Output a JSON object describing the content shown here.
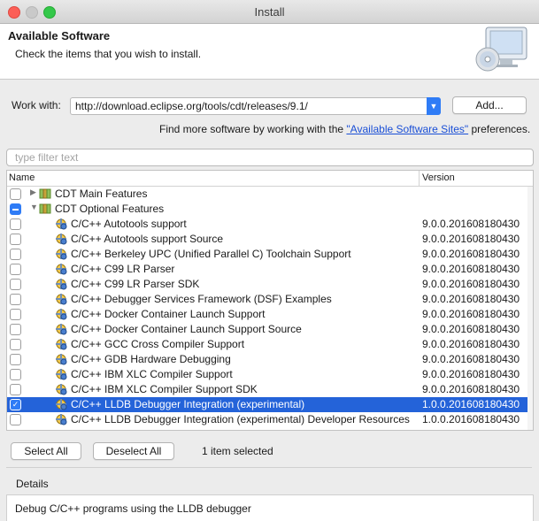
{
  "window": {
    "title": "Install"
  },
  "header": {
    "title": "Available Software",
    "subtitle": "Check the items that you wish to install."
  },
  "work_with": {
    "label": "Work with:",
    "url": "http://download.eclipse.org/tools/cdt/releases/9.1/",
    "add_label": "Add..."
  },
  "find_more": {
    "prefix": "Find more software by working with the ",
    "link": "\"Available Software Sites\"",
    "suffix": " preferences."
  },
  "filter": {
    "placeholder": "type filter text"
  },
  "table": {
    "col_name": "Name",
    "col_version": "Version",
    "rows": [
      {
        "name": "CDT Main Features",
        "version": "",
        "level": 0,
        "check": "none",
        "twisty": "▶",
        "icon": "feature-category-icon",
        "selected": false
      },
      {
        "name": "CDT Optional Features",
        "version": "",
        "level": 0,
        "check": "partial",
        "twisty": "▼",
        "icon": "feature-category-icon",
        "selected": false
      },
      {
        "name": "C/C++ Autotools support",
        "version": "9.0.0.201608180430",
        "level": 1,
        "check": "none",
        "icon": "plugin-feature-icon",
        "selected": false
      },
      {
        "name": "C/C++ Autotools support Source",
        "version": "9.0.0.201608180430",
        "level": 1,
        "check": "none",
        "icon": "plugin-feature-icon",
        "selected": false
      },
      {
        "name": "C/C++ Berkeley UPC (Unified Parallel C) Toolchain Support",
        "version": "9.0.0.201608180430",
        "level": 1,
        "check": "none",
        "icon": "plugin-feature-icon",
        "selected": false
      },
      {
        "name": "C/C++ C99 LR Parser",
        "version": "9.0.0.201608180430",
        "level": 1,
        "check": "none",
        "icon": "plugin-feature-icon",
        "selected": false
      },
      {
        "name": "C/C++ C99 LR Parser SDK",
        "version": "9.0.0.201608180430",
        "level": 1,
        "check": "none",
        "icon": "plugin-feature-icon",
        "selected": false
      },
      {
        "name": "C/C++ Debugger Services Framework (DSF) Examples",
        "version": "9.0.0.201608180430",
        "level": 1,
        "check": "none",
        "icon": "plugin-feature-icon",
        "selected": false
      },
      {
        "name": "C/C++ Docker Container Launch Support",
        "version": "9.0.0.201608180430",
        "level": 1,
        "check": "none",
        "icon": "plugin-feature-icon",
        "selected": false
      },
      {
        "name": "C/C++ Docker Container Launch Support Source",
        "version": "9.0.0.201608180430",
        "level": 1,
        "check": "none",
        "icon": "plugin-feature-icon",
        "selected": false
      },
      {
        "name": "C/C++ GCC Cross Compiler Support",
        "version": "9.0.0.201608180430",
        "level": 1,
        "check": "none",
        "icon": "plugin-feature-icon",
        "selected": false
      },
      {
        "name": "C/C++ GDB Hardware Debugging",
        "version": "9.0.0.201608180430",
        "level": 1,
        "check": "none",
        "icon": "plugin-feature-icon",
        "selected": false
      },
      {
        "name": "C/C++ IBM XLC Compiler Support",
        "version": "9.0.0.201608180430",
        "level": 1,
        "check": "none",
        "icon": "plugin-feature-icon",
        "selected": false
      },
      {
        "name": "C/C++ IBM XLC Compiler Support SDK",
        "version": "9.0.0.201608180430",
        "level": 1,
        "check": "none",
        "icon": "plugin-feature-icon",
        "selected": false
      },
      {
        "name": "C/C++ LLDB Debugger Integration (experimental)",
        "version": "1.0.0.201608180430",
        "level": 1,
        "check": "checked",
        "icon": "plugin-feature-icon",
        "selected": true
      },
      {
        "name": "C/C++ LLDB Debugger Integration (experimental) Developer Resources",
        "version": "1.0.0.201608180430",
        "level": 1,
        "check": "none",
        "icon": "plugin-feature-icon",
        "selected": false
      }
    ]
  },
  "actions": {
    "select_all": "Select All",
    "deselect_all": "Deselect All",
    "status": "1 item selected"
  },
  "details": {
    "label": "Details",
    "text": "Debug C/C++ programs using the LLDB debugger"
  },
  "colors": {
    "selection": "#2463d9",
    "accent": "#2f7cf6",
    "link": "#1a4fd6"
  }
}
